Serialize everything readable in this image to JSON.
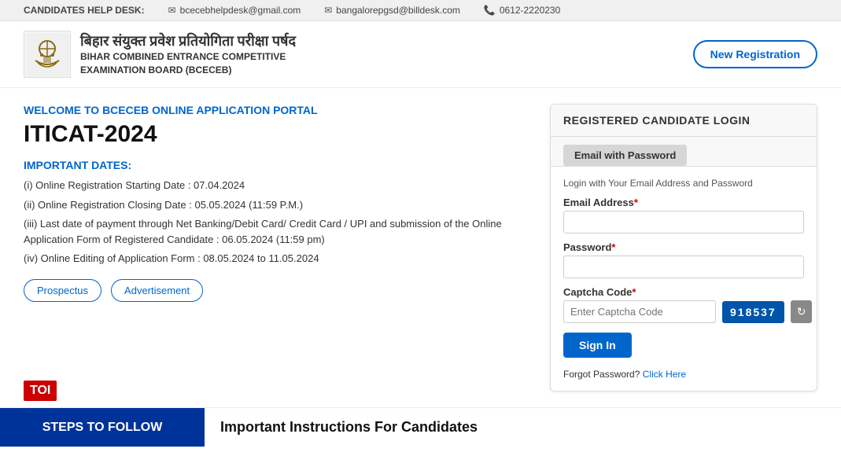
{
  "helpdesk": {
    "label": "CANDIDATES HELP DESK:",
    "email1": "bcecebhelpdesk@gmail.com",
    "email2": "bangalorepgsd@billdesk.com",
    "phone": "0612-2220230"
  },
  "header": {
    "logo_hi": "बिहार संयुक्त प्रवेश प्रतियोगिता परीक्षा पर्षद",
    "logo_en_line1": "BIHAR COMBINED ENTRANCE COMPETITIVE",
    "logo_en_line2": "EXAMINATION BOARD (BCECEB)",
    "new_registration_btn": "New Registration"
  },
  "left": {
    "welcome": "WELCOME TO BCECEB ONLINE APPLICATION PORTAL",
    "exam_title": "ITICAT-2024",
    "important_dates_title": "IMPORTANT DATES:",
    "dates": [
      "(i) Online Registration Starting Date : 07.04.2024",
      "(ii) Online Registration Closing Date : 05.05.2024 (11:59 P.M.)",
      "(iii) Last date of payment through Net Banking/Debit Card/ Credit Card / UPI and submission of the Online Application Form of Registered Candidate : 06.05.2024 (11:59 pm)",
      "(iv) Online Editing of Application Form : 08.05.2024 to 11.05.2024"
    ],
    "btn_prospectus": "Prospectus",
    "btn_advertisement": "Advertisement"
  },
  "login": {
    "header_title": "REGISTERED CANDIDATE LOGIN",
    "tab_label": "Email with Password",
    "subtitle": "Login with Your Email Address and Password",
    "email_label": "Email Address",
    "email_required": "*",
    "password_label": "Password",
    "password_required": "*",
    "captcha_label": "Captcha Code",
    "captcha_required": "*",
    "captcha_placeholder": "Enter Captcha Code",
    "captcha_code": "918537",
    "signin_btn": "Sign In",
    "forgot_text": "Forgot Password?",
    "forgot_link": "Click Here"
  },
  "bottom": {
    "steps_label": "STEPS TO FOLLOW",
    "instructions_label": "Important Instructions For Candidates"
  },
  "toi": {
    "label": "TOI"
  }
}
